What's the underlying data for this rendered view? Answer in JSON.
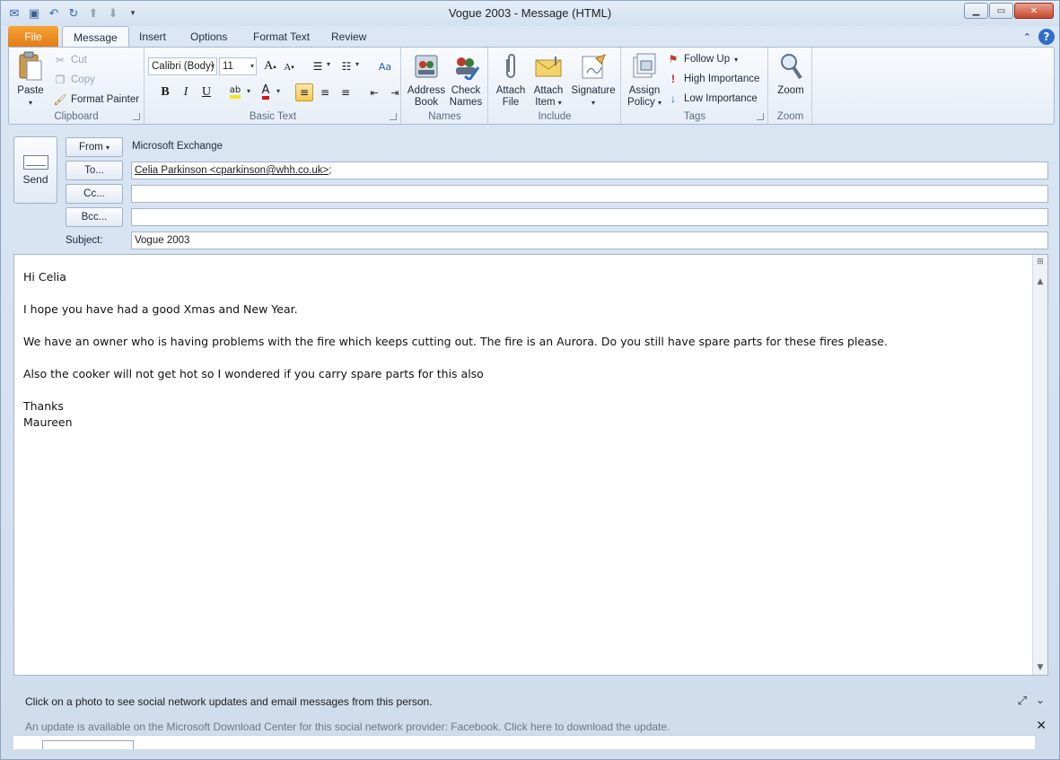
{
  "window": {
    "title": "Vogue 2003  -  Message (HTML)",
    "quick_access": [
      "outlook-icon",
      "save-icon",
      "undo-icon",
      "redo-icon",
      "up-icon",
      "down-icon",
      "customize-icon"
    ]
  },
  "tabs": {
    "file": "File",
    "message": "Message",
    "insert": "Insert",
    "options": "Options",
    "format_text": "Format Text",
    "review": "Review"
  },
  "ribbon": {
    "clipboard": {
      "label": "Clipboard",
      "paste": "Paste",
      "cut": "Cut",
      "copy": "Copy",
      "format_painter": "Format Painter"
    },
    "basic_text": {
      "label": "Basic Text",
      "font": "Calibri (Body)",
      "size": "11",
      "bold": "B",
      "italic": "I",
      "underline": "U",
      "grow": "A",
      "shrink": "A"
    },
    "names": {
      "label": "Names",
      "address_book_1": "Address",
      "address_book_2": "Book",
      "check_names_1": "Check",
      "check_names_2": "Names"
    },
    "include": {
      "label": "Include",
      "attach_file_1": "Attach",
      "attach_file_2": "File",
      "attach_item_1": "Attach",
      "attach_item_2": "Item",
      "signature": "Signature"
    },
    "tags": {
      "label": "Tags",
      "assign_policy_1": "Assign",
      "assign_policy_2": "Policy",
      "follow_up": "Follow Up",
      "high_importance": "High Importance",
      "low_importance": "Low Importance"
    },
    "zoom": {
      "label": "Zoom",
      "zoom": "Zoom"
    }
  },
  "header": {
    "send": "Send",
    "from_btn": "From",
    "from_value": "Microsoft Exchange",
    "to_btn": "To...",
    "to_value": "Celia Parkinson <cparkinson@whh.co.uk>",
    "to_suffix": ";",
    "cc_btn": "Cc...",
    "cc_value": "",
    "bcc_btn": "Bcc...",
    "bcc_value": "",
    "subject_label": "Subject:",
    "subject_value": "Vogue 2003"
  },
  "body": {
    "lines": [
      "Hi Celia",
      "",
      "I hope you have had a good Xmas and New Year.",
      "",
      "We have an owner who is having problems with the fire which keeps cutting out.  The fire is an Aurora.  Do you still have spare parts for these fires please.",
      "",
      "Also the cooker will not get hot so I wondered if you carry spare parts for this also",
      "",
      "Thanks",
      "Maureen"
    ]
  },
  "people_pane": {
    "info": "Click on a photo to see social network updates and email messages from this person.",
    "update": "An update is available on the Microsoft Download Center for this social network provider: Facebook. Click here to download the update."
  },
  "colors": {
    "file_tab": "#e27b17",
    "accent": "#2f6fcb",
    "selected": "#f7c94f"
  }
}
